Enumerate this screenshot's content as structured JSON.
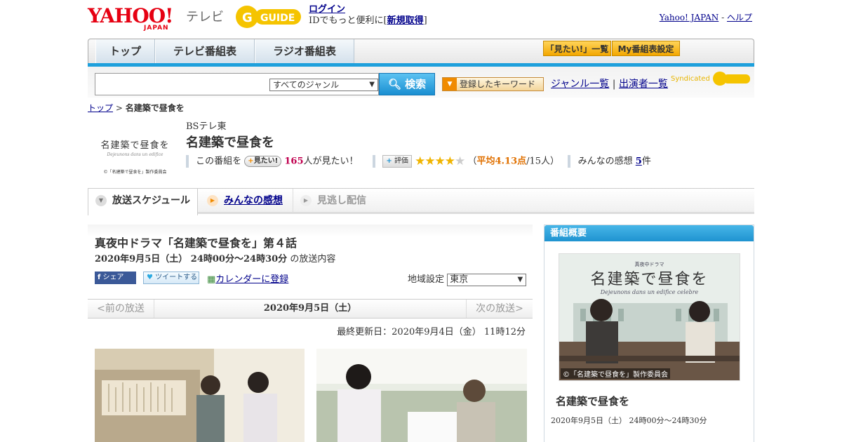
{
  "header": {
    "logo_main": "YAHOO!",
    "logo_sub": "JAPAN",
    "logo_tv": "テレビ",
    "gguide_text": "G GUIDE",
    "login": "ログイン",
    "login_desc_pre": "IDでもっと便利に[",
    "register": "新規取得",
    "login_desc_post": "]",
    "yahoo_japan": "Yahoo! JAPAN",
    "separator": " - ",
    "help": "ヘルプ"
  },
  "nav": {
    "tabs": [
      "トップ",
      "テレビ番組表",
      "ラジオ番組表"
    ],
    "want_list": "「見たい!」一覧",
    "my_schedule": "My番組表設定"
  },
  "search": {
    "genre_selected": "すべてのジャンル",
    "button": "検索",
    "keyword_btn": "登録したキーワード",
    "genre_list": "ジャンル一覧",
    "divider": "|",
    "cast_list": "出演者一覧",
    "syndicated": "Syndicated"
  },
  "breadcrumb": {
    "top": "トップ",
    "sep": " > ",
    "current": "名建築で昼食を"
  },
  "program": {
    "thumb_title": "名建築で昼食を",
    "thumb_sub": "Dejeunons dans un edifice",
    "thumb_copy": "©「名建築で昼食を」製作委員会",
    "channel": "BSテレ東",
    "title": "名建築で昼食を",
    "want_pre": "この番組を",
    "want_btn": "見たい!",
    "want_count": "165",
    "want_post": "人が見たい！",
    "rate_btn": "評価",
    "stars_filled": "★★★★",
    "stars_empty": "★",
    "avg_open": "（",
    "avg": "平均4.13点",
    "avg_post": "/15人）",
    "impressions_pre": "みんなの感想",
    "impressions_count": "5",
    "impressions_post": "件"
  },
  "tabs": {
    "schedule": "放送スケジュール",
    "impressions": "みんなの感想",
    "streaming": "見逃し配信"
  },
  "episode": {
    "title": "真夜中ドラマ「名建築で昼食を」第４話",
    "time": "2020年9月5日（土） 24時00分～24時30分",
    "time_post": "の放送内容",
    "share": "シェア",
    "tweet": "ツイートする",
    "calendar": "カレンダーに登録",
    "region_label": "地域設定",
    "region_value": "東京"
  },
  "datebar": {
    "prev": "<前の放送",
    "current": "2020年9月5日（土）",
    "next": "次の放送>"
  },
  "updated": "最終更新日：2020年9月4日（金） 11時12分",
  "side": {
    "header": "番組概要",
    "img_sub": "真夜中ドラマ",
    "img_title": "名建築で昼食を",
    "img_italic": "Dejeunons dans un edifice celebre",
    "img_copy": "©「名建築で昼食を」製作委員会",
    "title": "名建築で昼食を",
    "time": "2020年9月5日（土） 24時00分～24時30分"
  }
}
